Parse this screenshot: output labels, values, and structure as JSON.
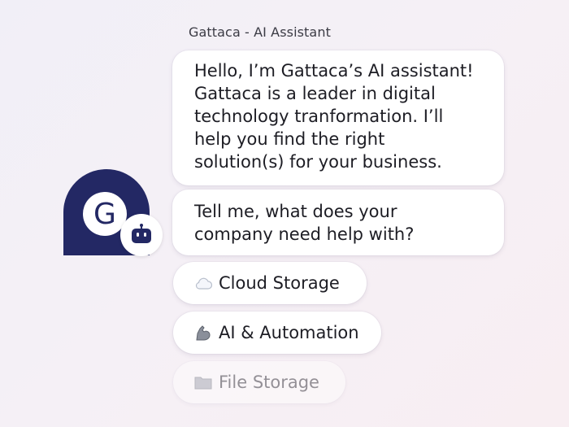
{
  "header": {
    "sender_name": "Gattaca - AI Assistant"
  },
  "messages": [
    {
      "text": "Hello, I’m Gattaca’s AI assistant!\nGattaca is a leader in digital\ntechnology tranformation. I’ll\nhelp you find the right\nsolution(s) for your business."
    },
    {
      "text": "Tell me, what does your\ncompany need help with?"
    }
  ],
  "avatar": {
    "letter": "G",
    "color": "#232864",
    "badge_icon": "robot-icon"
  },
  "options": [
    {
      "label": "Cloud Storage",
      "icon": "cloud-icon"
    },
    {
      "label": "AI & Automation",
      "icon": "flexed-arm-icon"
    },
    {
      "label": "File Storage",
      "icon": "folder-icon"
    }
  ]
}
